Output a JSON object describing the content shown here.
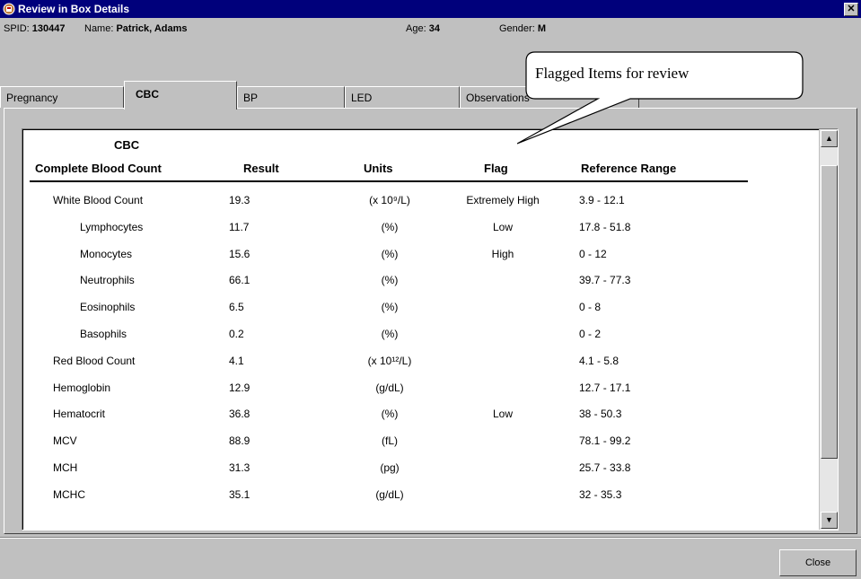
{
  "window": {
    "title": "Review in Box Details",
    "close_glyph": "✕"
  },
  "patient": {
    "spid_label": "SPID:",
    "spid_value": "130447",
    "name_label": "Name:",
    "name_value": "Patrick, Adams",
    "age_label": "Age:",
    "age_value": "34",
    "gender_label": "Gender:",
    "gender_value": "M"
  },
  "tabs": [
    {
      "label": "Pregnancy"
    },
    {
      "label": "CBC"
    },
    {
      "label": "BP"
    },
    {
      "label": "LED"
    },
    {
      "label": "Observations"
    }
  ],
  "callout": {
    "text": "Flagged Items for review"
  },
  "cbc": {
    "title": "CBC",
    "headers": {
      "name": "Complete Blood Count",
      "result": "Result",
      "units": "Units",
      "flag": "Flag",
      "range": "Reference Range"
    },
    "rows": [
      {
        "name": "White Blood Count",
        "indent": false,
        "result": "19.3",
        "units": "(x 10⁹/L)",
        "flag": "Extremely High",
        "range": "3.9 - 12.1"
      },
      {
        "name": "Lymphocytes",
        "indent": true,
        "result": "11.7",
        "units": "(%)",
        "flag": "Low",
        "range": "17.8 - 51.8"
      },
      {
        "name": "Monocytes",
        "indent": true,
        "result": "15.6",
        "units": "(%)",
        "flag": "High",
        "range": "0 - 12"
      },
      {
        "name": "Neutrophils",
        "indent": true,
        "result": "66.1",
        "units": "(%)",
        "flag": "",
        "range": "39.7 - 77.3"
      },
      {
        "name": "Eosinophils",
        "indent": true,
        "result": "6.5",
        "units": "(%)",
        "flag": "",
        "range": "0 - 8"
      },
      {
        "name": "Basophils",
        "indent": true,
        "result": "0.2",
        "units": "(%)",
        "flag": "",
        "range": "0 - 2"
      },
      {
        "name": "Red Blood Count",
        "indent": false,
        "result": "4.1",
        "units": "(x 10¹²/L)",
        "flag": "",
        "range": "4.1 - 5.8"
      },
      {
        "name": "Hemoglobin",
        "indent": false,
        "result": "12.9",
        "units": "(g/dL)",
        "flag": "",
        "range": "12.7 - 17.1"
      },
      {
        "name": "Hematocrit",
        "indent": false,
        "result": "36.8",
        "units": "(%)",
        "flag": "Low",
        "range": "38 - 50.3"
      },
      {
        "name": "MCV",
        "indent": false,
        "result": "88.9",
        "units": "(fL)",
        "flag": "",
        "range": "78.1 - 99.2"
      },
      {
        "name": "MCH",
        "indent": false,
        "result": "31.3",
        "units": "(pg)",
        "flag": "",
        "range": "25.7 - 33.8"
      },
      {
        "name": "MCHC",
        "indent": false,
        "result": "35.1",
        "units": "(g/dL)",
        "flag": "",
        "range": "32 - 35.3"
      }
    ]
  },
  "buttons": {
    "close": "Close"
  },
  "scroll": {
    "up_glyph": "▲",
    "down_glyph": "▼"
  }
}
